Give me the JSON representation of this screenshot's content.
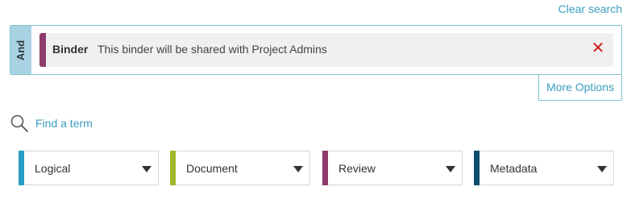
{
  "header": {
    "clear_search": "Clear search"
  },
  "query": {
    "operator": "And",
    "criterion": {
      "field": "Binder",
      "text": "This binder will be shared with Project Admins",
      "remove_symbol": "✕",
      "accent_color": "#8f3b6b"
    },
    "more_options": "More Options"
  },
  "find_term": {
    "label": "Find a term",
    "icon": "search-icon"
  },
  "categories": [
    {
      "label": "Logical",
      "color": "#2a9cc4"
    },
    {
      "label": "Document",
      "color": "#9fb82a"
    },
    {
      "label": "Review",
      "color": "#8f3b6b"
    },
    {
      "label": "Metadata",
      "color": "#0f4d6e"
    }
  ]
}
